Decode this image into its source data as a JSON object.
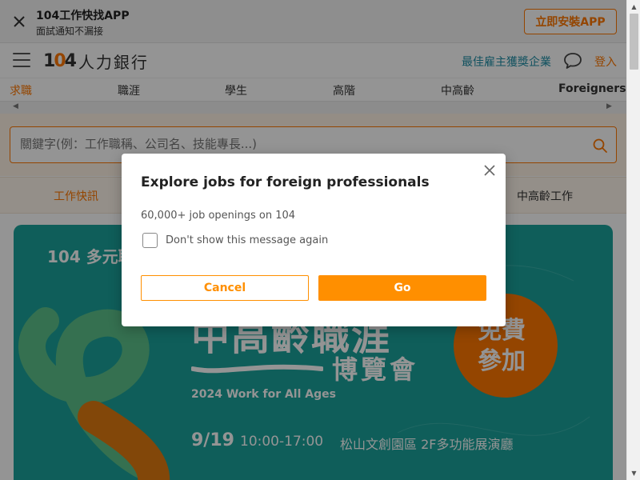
{
  "app_banner": {
    "title": "104工作快找APP",
    "subtitle": "面試通知不漏接",
    "install_label": "立即安裝APP"
  },
  "header": {
    "logo_number": "104",
    "logo_text": "人力銀行",
    "best_employer_label": "最佳雇主獲獎企業",
    "login_label": "登入"
  },
  "category_tabs": [
    {
      "label": "求職",
      "active": true
    },
    {
      "label": "職涯",
      "active": false
    },
    {
      "label": "學生",
      "active": false
    },
    {
      "label": "高階",
      "active": false
    },
    {
      "label": "中高齡",
      "active": false
    },
    {
      "label": "Foreigners",
      "active": false
    }
  ],
  "search": {
    "placeholder": "關鍵字(例：工作職稱、公司名、技能專長...)"
  },
  "quick_links": [
    {
      "label": "工作快訊",
      "color": "#ff7800"
    },
    {
      "label": "中高齡工作",
      "color": "#333333"
    }
  ],
  "promo_banner": {
    "logo": "104 多元職",
    "title": "中高齡職涯",
    "subtitle": "博覽會",
    "english": "2024 Work for All Ages",
    "date": "9/19",
    "time": "10:00-17:00",
    "venue": "松山文創園區  2F多功能展演廳",
    "badge": "免費參加"
  },
  "modal": {
    "title": "Explore jobs for foreign professionals",
    "subtitle": "60,000+ job openings on 104",
    "checkbox_label": "Don't show this message again",
    "checkbox_checked": false,
    "cancel_label": "Cancel",
    "go_label": "Go"
  },
  "colors": {
    "brand_orange": "#ff7800",
    "modal_button_orange": "#ff8f00",
    "teal_link": "#1f8ea5",
    "promo_teal": "#1ba29b"
  }
}
